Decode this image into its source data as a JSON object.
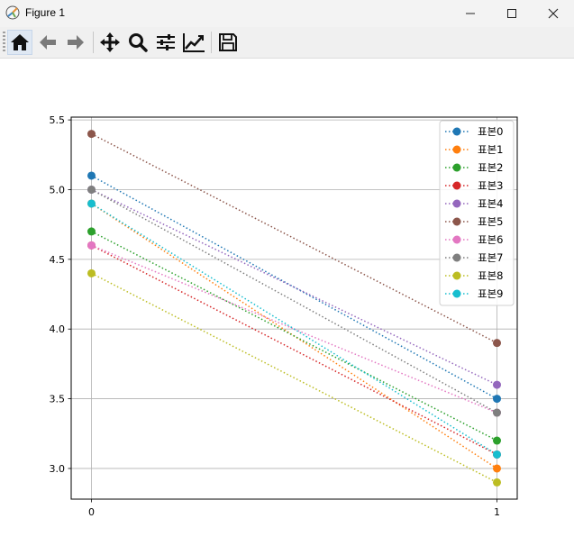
{
  "window": {
    "title": "Figure 1"
  },
  "toolbar": {
    "buttons": [
      {
        "icon": "home-icon"
      },
      {
        "icon": "back-arrow-icon"
      },
      {
        "icon": "forward-arrow-icon"
      },
      {
        "icon": "pan-move-icon"
      },
      {
        "icon": "zoom-magnifier-icon"
      },
      {
        "icon": "configure-subplots-icon"
      },
      {
        "icon": "edit-axes-icon"
      },
      {
        "icon": "save-icon"
      }
    ]
  },
  "chart_data": {
    "type": "line",
    "title": "",
    "xlabel": "",
    "ylabel": "",
    "x": [
      0,
      1
    ],
    "xticks": [
      0,
      1
    ],
    "yticks": [
      "3.0",
      "3.5",
      "4.0",
      "4.5",
      "5.0",
      "5.5"
    ],
    "xlim": [
      -0.05,
      1.05
    ],
    "ylim": [
      2.78,
      5.52
    ],
    "grid": true,
    "line_style": "dotted",
    "marker": "circle",
    "legend_position": "upper-right",
    "series": [
      {
        "name": "표본0",
        "color": "#1f77b4",
        "values": [
          5.1,
          3.5
        ]
      },
      {
        "name": "표본1",
        "color": "#ff7f0e",
        "values": [
          4.9,
          3.0
        ]
      },
      {
        "name": "표본2",
        "color": "#2ca02c",
        "values": [
          4.7,
          3.2
        ]
      },
      {
        "name": "표본3",
        "color": "#d62728",
        "values": [
          4.6,
          3.1
        ]
      },
      {
        "name": "표본4",
        "color": "#9467bd",
        "values": [
          5.0,
          3.6
        ]
      },
      {
        "name": "표본5",
        "color": "#8c564b",
        "values": [
          5.4,
          3.9
        ]
      },
      {
        "name": "표본6",
        "color": "#e377c2",
        "values": [
          4.6,
          3.4
        ]
      },
      {
        "name": "표본7",
        "color": "#7f7f7f",
        "values": [
          5.0,
          3.4
        ]
      },
      {
        "name": "표본8",
        "color": "#bcbd22",
        "values": [
          4.4,
          2.9
        ]
      },
      {
        "name": "표본9",
        "color": "#17becf",
        "values": [
          4.9,
          3.1
        ]
      }
    ]
  }
}
